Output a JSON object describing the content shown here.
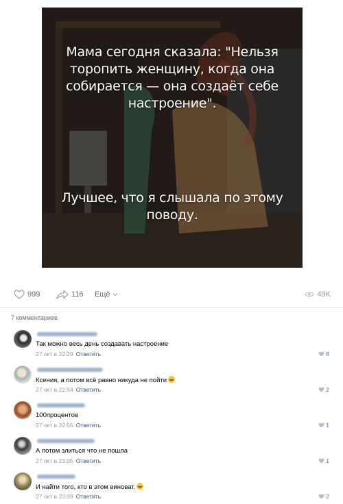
{
  "post": {
    "quote_part1": "Мама сегодня сказала: \"Нельзя торопить женщину, когда она собирается — она создаёт себе настроение\".",
    "quote_part2": "Лучшее, что я слышала по этому поводу."
  },
  "actions": {
    "likes": "999",
    "shares": "116",
    "more_label": "Ещё",
    "views": "49K"
  },
  "comments_count": "7 комментариев",
  "colors": {
    "link": "#2a5885",
    "muted": "#8d98a6",
    "icon": "#99a6b6"
  },
  "comments": [
    {
      "text": "Так можно весь день создавать настроение",
      "time": "27 окт в 22:29",
      "reply": "Ответить",
      "likes": "6",
      "emoji": false
    },
    {
      "text": "Ксения, а потом всё равно никуда не пойти",
      "time": "27 окт в 22:54",
      "reply": "Ответить",
      "likes": "2",
      "emoji": true
    },
    {
      "text": "100процентов",
      "time": "27 окт в 22:55",
      "reply": "Ответить",
      "likes": "1",
      "emoji": false
    },
    {
      "text": "А потом злиться что не пошла",
      "time": "27 окт в 23:05",
      "reply": "Ответить",
      "likes": "1",
      "emoji": false
    },
    {
      "text": "И найти того, кто в этом виноват.",
      "time": "27 окт в 23:09",
      "reply": "Ответить",
      "likes": "2",
      "emoji": true
    }
  ]
}
